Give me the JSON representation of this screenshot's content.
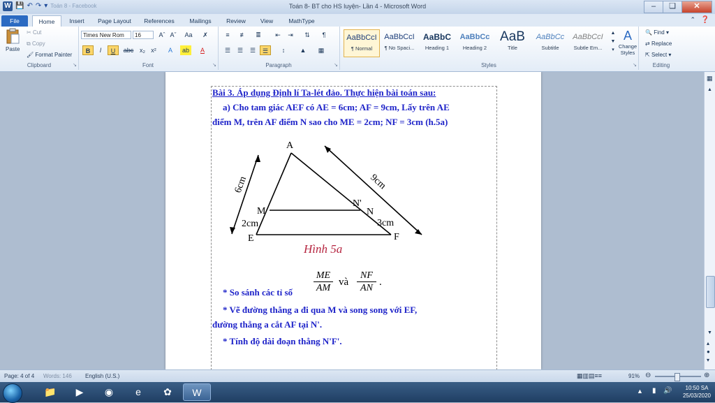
{
  "window": {
    "title": "Toán 8- BT cho HS luyện- Lần 4  -  Microsoft Word",
    "qat_doc": "Toán 8 - Facebook"
  },
  "tabs": [
    "File",
    "Home",
    "Insert",
    "Page Layout",
    "References",
    "Mailings",
    "Review",
    "View",
    "MathType"
  ],
  "active_tab": "Home",
  "clipboard": {
    "paste": "Paste",
    "cut": "Cut",
    "copy": "Copy",
    "format_painter": "Format Painter",
    "label": "Clipboard"
  },
  "font": {
    "name": "Times New Rom",
    "size": "16",
    "label": "Font"
  },
  "paragraph": {
    "label": "Paragraph"
  },
  "styles": {
    "label": "Styles",
    "items": [
      {
        "sample": "AaBbCcI",
        "name": "¶ Normal"
      },
      {
        "sample": "AaBbCcI",
        "name": "¶ No Spaci..."
      },
      {
        "sample": "AaBbC",
        "name": "Heading 1"
      },
      {
        "sample": "AaBbCc",
        "name": "Heading 2"
      },
      {
        "sample": "AaB",
        "name": "Title"
      },
      {
        "sample": "AaBbCc",
        "name": "Subtitle"
      },
      {
        "sample": "AaBbCcI",
        "name": "Subtle Em..."
      }
    ],
    "change_styles": "Change Styles"
  },
  "editing": {
    "find": "Find",
    "replace": "Replace",
    "select": "Select",
    "label": "Editing"
  },
  "document": {
    "heading": "Bài 3. Áp dụng Định lí Ta-lét đảo. Thực hiện bài toán sau:",
    "para_a_line1": "a) Cho tam giác AEF có AE = 6cm; AF = 9cm, Lấy trên AE",
    "para_a_line2": "điểm M, trên AF điểm N sao cho ME = 2cm; NF = 3cm (h.5a)",
    "figure": {
      "caption": "Hình 5a",
      "labels": {
        "A": "A",
        "M": "M",
        "E": "E",
        "F": "F",
        "N": "N",
        "N_prime": "N'",
        "ae_len": "6cm",
        "af_len": "9cm",
        "me_len": "2cm",
        "nf_len": "3cm"
      }
    },
    "fraction1": {
      "num": "ME",
      "den": "AM"
    },
    "fraction_joiner": "và",
    "fraction2": {
      "num": "NF",
      "den": "AN"
    },
    "fraction_end": ".",
    "bullet1": "* So sánh các tỉ số",
    "bullet2_line1": "* Vẽ đường thẳng a đi qua M và song song với EF,",
    "bullet2_line2": "đường thẳng a cắt AF tại N'.",
    "bullet3": "* Tính độ dài đoạn thẳng N'F'."
  },
  "status": {
    "page": "Page: 4 of 4",
    "words": "Words: 146",
    "language": "English (U.S.)",
    "zoom": "91%"
  },
  "taskbar": {
    "time": "10:50 SA",
    "date": "25/03/2020"
  }
}
